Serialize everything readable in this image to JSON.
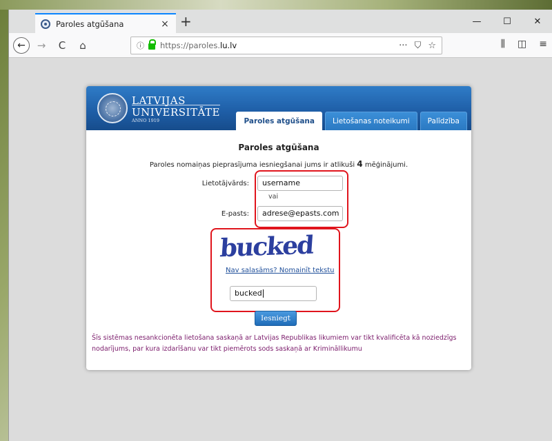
{
  "browser": {
    "tab_title": "Paroles atgūšana",
    "tab_close": "×",
    "new_tab": "+",
    "url_prefix": "https://paroles.",
    "url_domain": "lu.lv",
    "url_more": "···",
    "win_minimize": "—",
    "win_maximize": "☐",
    "win_close": "✕",
    "icons": {
      "back": "←",
      "forward": "→",
      "reload": "C",
      "home": "⌂",
      "info": "ⓘ",
      "pocket": "⛉",
      "bookmark": "☆",
      "library": "⫼",
      "sidebar": "◫",
      "menu": "≡"
    }
  },
  "header": {
    "logo_line1": "LATVIJAS",
    "logo_line2": "UNIVERSITĀTE",
    "logo_line3": "ANNO 1919",
    "tabs": [
      {
        "label": "Paroles atgūšana",
        "active": true
      },
      {
        "label": "Lietošanas noteikumi",
        "active": false
      },
      {
        "label": "Palīdzība",
        "active": false
      }
    ]
  },
  "form": {
    "heading": "Paroles atgūšana",
    "attempts_before": "Paroles nomaiņas pieprasījuma iesniegšanai jums ir atlikuši",
    "attempts_count": "4",
    "attempts_after": "mēģinājumi.",
    "username_label": "Lietotājvārds:",
    "username_value": "username",
    "or_text": "vai",
    "email_label": "E-pasts:",
    "email_value": "adrese@epasts.com",
    "captcha_text": "bucked",
    "reload_link": "Nav salasāms? Nomainīt tekstu",
    "captcha_value": "bucked",
    "submit_label": "Iesniegt",
    "warning": "Šīs sistēmas nesankcionēta lietošana saskaņā ar Latvijas Republikas likumiem var tikt kvalificēta kā noziedzīgs nodarījums, par kura izdarīšanu var tikt piemērots sods saskaņā ar Krimināllikumu"
  },
  "colors": {
    "highlight_box": "#e0141c",
    "header_blue": "#1f5fa8",
    "warning_text": "#7a1a6a"
  }
}
